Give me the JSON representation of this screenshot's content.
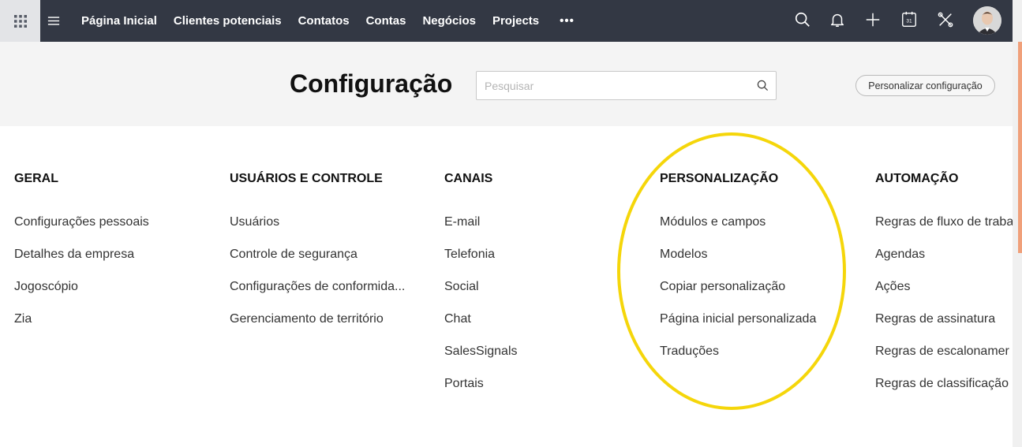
{
  "topbar": {
    "nav": [
      "Página Inicial",
      "Clientes potenciais",
      "Contatos",
      "Contas",
      "Negócios",
      "Projects"
    ],
    "more_label": "•••",
    "icons": [
      "search-icon",
      "bell-icon",
      "plus-icon",
      "calendar-icon",
      "tools-icon"
    ],
    "calendar_day": "31",
    "colors": {
      "bar": "#333844",
      "grid_bg": "#e3e4e7"
    }
  },
  "header": {
    "title": "Configuração",
    "search_placeholder": "Pesquisar",
    "search_value": "",
    "customize_label": "Personalizar configuração"
  },
  "columns": [
    {
      "title": "GERAL",
      "items": [
        "Configurações pessoais",
        "Detalhes da empresa",
        "Jogoscópio",
        "Zia"
      ]
    },
    {
      "title": "USUÁRIOS E CONTROLE",
      "items": [
        "Usuários",
        "Controle de segurança",
        "Configurações de conformida...",
        "Gerenciamento de território"
      ]
    },
    {
      "title": "CANAIS",
      "items": [
        "E-mail",
        "Telefonia",
        "Social",
        "Chat",
        "SalesSignals",
        "Portais"
      ]
    },
    {
      "title": "PERSONALIZAÇÃO",
      "items": [
        "Módulos e campos",
        "Modelos",
        "Copiar personalização",
        "Página inicial personalizada",
        "Traduções"
      ]
    },
    {
      "title": "AUTOMAÇÃO",
      "items": [
        "Regras de fluxo de traba",
        "Agendas",
        "Ações",
        "Regras de assinatura",
        "Regras de escalonamer",
        "Regras de classificação"
      ]
    }
  ],
  "annotation": {
    "color": "#f5d60a"
  }
}
